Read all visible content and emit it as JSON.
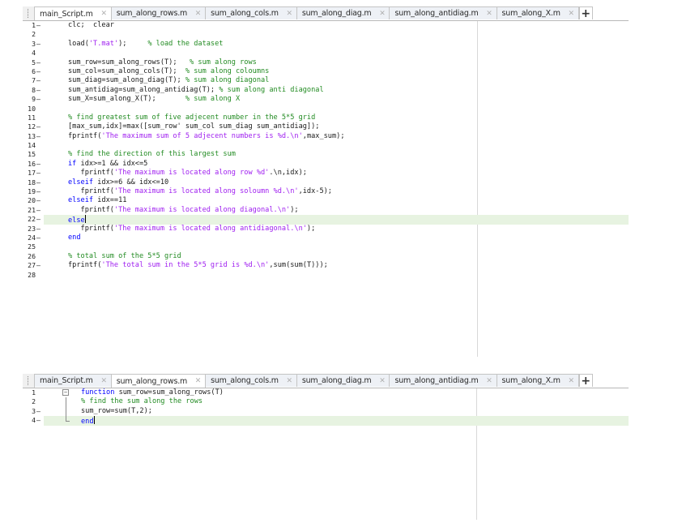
{
  "editor1": {
    "tabs": [
      {
        "label": "main_Script.m",
        "active": true
      },
      {
        "label": "sum_along_rows.m",
        "active": false
      },
      {
        "label": "sum_along_cols.m",
        "active": false
      },
      {
        "label": "sum_along_diag.m",
        "active": false
      },
      {
        "label": "sum_along_antidiag.m",
        "active": false
      },
      {
        "label": "sum_along_X.m",
        "active": false
      }
    ],
    "add_tab_label": "+",
    "highlight_line": 22,
    "lines": [
      {
        "n": "1",
        "dash": true,
        "seg": [
          [
            "",
            "clc;  clear"
          ]
        ]
      },
      {
        "n": "2",
        "dash": false,
        "seg": []
      },
      {
        "n": "3",
        "dash": true,
        "seg": [
          [
            "",
            "load("
          ],
          [
            "s",
            "'T.mat'"
          ],
          [
            "",
            ");     "
          ],
          [
            "c",
            "% load the dataset"
          ]
        ]
      },
      {
        "n": "4",
        "dash": false,
        "seg": []
      },
      {
        "n": "5",
        "dash": true,
        "seg": [
          [
            "",
            "sum_row=sum_along_rows(T);   "
          ],
          [
            "c",
            "% sum along rows"
          ]
        ]
      },
      {
        "n": "6",
        "dash": true,
        "seg": [
          [
            "",
            "sum_col=sum_along_cols(T);  "
          ],
          [
            "c",
            "% sum along coloumns"
          ]
        ]
      },
      {
        "n": "7",
        "dash": true,
        "seg": [
          [
            "",
            "sum_diag=sum_along_diag(T); "
          ],
          [
            "c",
            "% sum along diagonal"
          ]
        ]
      },
      {
        "n": "8",
        "dash": true,
        "seg": [
          [
            "",
            "sum_antidiag=sum_along_antidiag(T); "
          ],
          [
            "c",
            "% sum along anti diagonal"
          ]
        ]
      },
      {
        "n": "9",
        "dash": true,
        "seg": [
          [
            "",
            "sum_X=sum_along_X(T);       "
          ],
          [
            "c",
            "% sum along X"
          ]
        ]
      },
      {
        "n": "10",
        "dash": false,
        "seg": []
      },
      {
        "n": "11",
        "dash": false,
        "seg": [
          [
            "c",
            "% find greatest sum of five adjecent number in the 5*5 grid"
          ]
        ]
      },
      {
        "n": "12",
        "dash": true,
        "seg": [
          [
            "",
            "[max_sum,idx]=max([sum_row' sum_col sum_diag sum_antidiag]);"
          ]
        ]
      },
      {
        "n": "13",
        "dash": true,
        "seg": [
          [
            "",
            "fprintf("
          ],
          [
            "s",
            "'The maximum sum of 5 adjecent numbers is %d.\\n'"
          ],
          [
            "",
            ",max_sum);"
          ]
        ]
      },
      {
        "n": "14",
        "dash": false,
        "seg": []
      },
      {
        "n": "15",
        "dash": false,
        "seg": [
          [
            "c",
            "% find the direction of this largest sum"
          ]
        ]
      },
      {
        "n": "16",
        "dash": true,
        "seg": [
          [
            "k",
            "if"
          ],
          [
            "",
            " idx>=1 && idx<=5"
          ]
        ]
      },
      {
        "n": "17",
        "dash": true,
        "seg": [
          [
            "",
            "   fprintf("
          ],
          [
            "s",
            "'The maximum is located along row %d'"
          ],
          [
            "",
            ".\\n,idx);"
          ]
        ]
      },
      {
        "n": "18",
        "dash": true,
        "seg": [
          [
            "k",
            "elseif"
          ],
          [
            "",
            " idx>=6 && idx<=10"
          ]
        ]
      },
      {
        "n": "19",
        "dash": true,
        "seg": [
          [
            "",
            "   fprintf("
          ],
          [
            "s",
            "'The maximum is located along soloumn %d.\\n'"
          ],
          [
            "",
            ",idx-5);"
          ]
        ]
      },
      {
        "n": "20",
        "dash": true,
        "seg": [
          [
            "k",
            "elseif"
          ],
          [
            "",
            " idx==11"
          ]
        ]
      },
      {
        "n": "21",
        "dash": true,
        "seg": [
          [
            "",
            "   fprintf("
          ],
          [
            "s",
            "'The maximum is located along diagonal.\\n'"
          ],
          [
            "",
            ");"
          ]
        ]
      },
      {
        "n": "22",
        "dash": true,
        "seg": [
          [
            "k",
            "else"
          ]
        ]
      },
      {
        "n": "23",
        "dash": true,
        "seg": [
          [
            "",
            "   fprintf("
          ],
          [
            "s",
            "'The maximum is located along antidiagonal.\\n'"
          ],
          [
            "",
            ");"
          ]
        ]
      },
      {
        "n": "24",
        "dash": true,
        "seg": [
          [
            "k",
            "end"
          ]
        ]
      },
      {
        "n": "25",
        "dash": false,
        "seg": []
      },
      {
        "n": "26",
        "dash": false,
        "seg": [
          [
            "c",
            "% total sum of the 5*5 grid"
          ]
        ]
      },
      {
        "n": "27",
        "dash": true,
        "seg": [
          [
            "",
            "fprintf("
          ],
          [
            "s",
            "'The total sum in the 5*5 grid is %d.\\n'"
          ],
          [
            "",
            ",sum(sum(T)));"
          ]
        ]
      },
      {
        "n": "28",
        "dash": false,
        "seg": []
      }
    ]
  },
  "editor2": {
    "tabs": [
      {
        "label": "main_Script.m",
        "active": false
      },
      {
        "label": "sum_along_rows.m",
        "active": true
      },
      {
        "label": "sum_along_cols.m",
        "active": false
      },
      {
        "label": "sum_along_diag.m",
        "active": false
      },
      {
        "label": "sum_along_antidiag.m",
        "active": false
      },
      {
        "label": "sum_along_X.m",
        "active": false
      }
    ],
    "add_tab_label": "+",
    "highlight_line": 4,
    "lines": [
      {
        "n": "1",
        "dash": false,
        "seg": [
          [
            "k",
            "function"
          ],
          [
            "",
            " sum_row=sum_along_rows(T)"
          ]
        ]
      },
      {
        "n": "2",
        "dash": false,
        "seg": [
          [
            "c",
            "% find the sum along the rows"
          ]
        ]
      },
      {
        "n": "3",
        "dash": true,
        "seg": [
          [
            "",
            "sum_row=sum(T,2);"
          ]
        ]
      },
      {
        "n": "4",
        "dash": true,
        "seg": [
          [
            "k",
            "end"
          ]
        ]
      }
    ]
  }
}
